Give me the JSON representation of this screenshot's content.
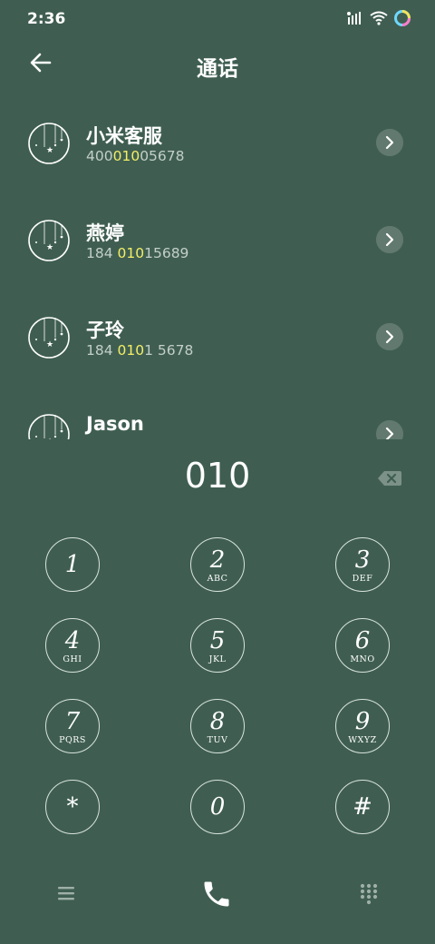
{
  "status_bar": {
    "time": "2:36"
  },
  "header": {
    "title": "通话"
  },
  "contacts": [
    {
      "name": "小米客服",
      "number_pre": "400",
      "number_match": "010",
      "number_post": "05678"
    },
    {
      "name": "燕婷",
      "number_pre": "184 ",
      "number_match": "010",
      "number_post": "15689"
    },
    {
      "name": "子玲",
      "number_pre": "184 ",
      "number_match": "010",
      "number_post": "1 5678"
    },
    {
      "name": "Jason",
      "number_pre": "",
      "number_match": "",
      "number_post": ""
    }
  ],
  "dialer": {
    "input": "010"
  },
  "keypad": [
    {
      "digit": "1",
      "letters": ""
    },
    {
      "digit": "2",
      "letters": "ABC"
    },
    {
      "digit": "3",
      "letters": "DEF"
    },
    {
      "digit": "4",
      "letters": "GHI"
    },
    {
      "digit": "5",
      "letters": "JKL"
    },
    {
      "digit": "6",
      "letters": "MNO"
    },
    {
      "digit": "7",
      "letters": "PQRS"
    },
    {
      "digit": "8",
      "letters": "TUV"
    },
    {
      "digit": "9",
      "letters": "WXYZ"
    },
    {
      "digit": "*",
      "letters": ""
    },
    {
      "digit": "0",
      "letters": ""
    },
    {
      "digit": "#",
      "letters": ""
    }
  ],
  "icons": {
    "back": "back-arrow-icon",
    "backspace": "backspace-icon",
    "menu": "menu-icon",
    "call": "phone-icon",
    "keypad": "keypad-icon"
  },
  "colors": {
    "background": "#3f5e51",
    "highlight": "#f4ee66",
    "secondary_text": "#c3cfc9"
  }
}
